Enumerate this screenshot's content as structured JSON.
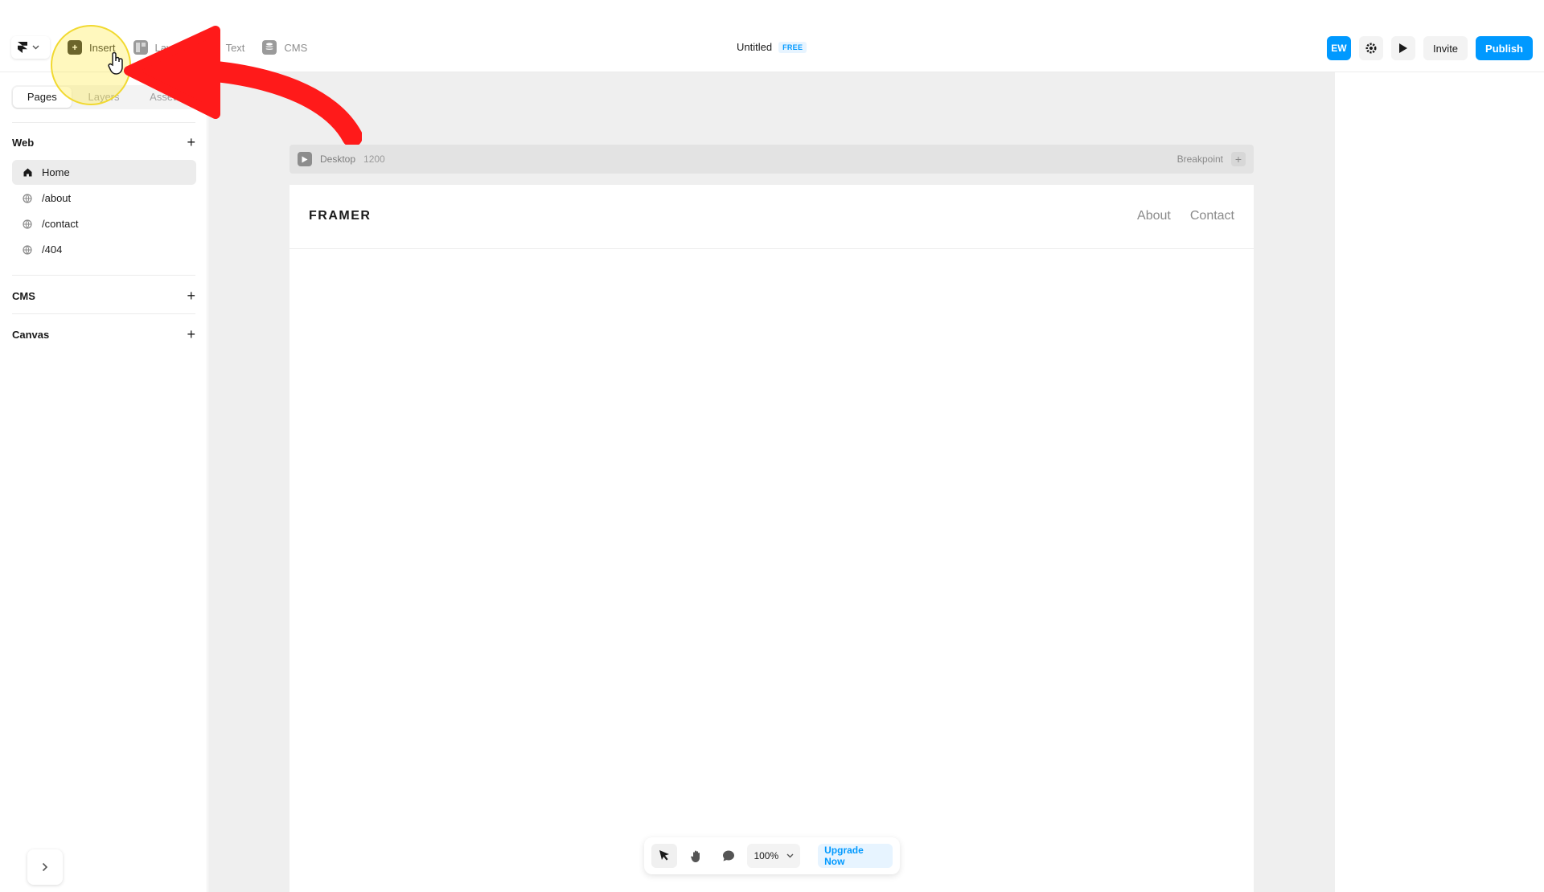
{
  "toolbar": {
    "tools": [
      {
        "label": "Insert",
        "icon": "plus-square-icon"
      },
      {
        "label": "Layout",
        "icon": "layout-icon"
      },
      {
        "label": "Text",
        "icon": "text-icon"
      },
      {
        "label": "CMS",
        "icon": "database-icon"
      }
    ],
    "title": "Untitled",
    "badge": "FREE",
    "avatar": "EW",
    "invite": "Invite",
    "publish": "Publish"
  },
  "sidebar": {
    "tabs": [
      "Pages",
      "Layers",
      "Assets"
    ],
    "web_section": "Web",
    "pages": [
      "Home",
      "/about",
      "/contact",
      "/404"
    ],
    "cms_section": "CMS",
    "canvas_section": "Canvas"
  },
  "canvas": {
    "breakpoint_name": "Desktop",
    "breakpoint_width": "1200",
    "breakpoint_label": "Breakpoint",
    "site_logo": "FRAMER",
    "nav_links": [
      "About",
      "Contact"
    ]
  },
  "bottom_toolbar": {
    "zoom": "100%",
    "upgrade": "Upgrade Now"
  },
  "colors": {
    "accent": "#0099ff",
    "canvas_bg": "#efefef",
    "annotation_arrow": "#ff1a1a",
    "annotation_highlight": "#f1d931"
  }
}
